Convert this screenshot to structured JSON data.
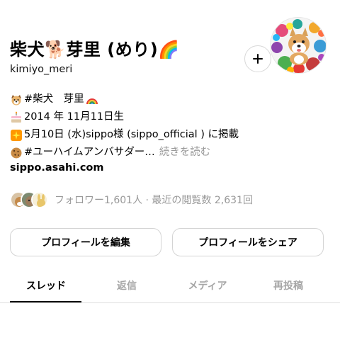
{
  "profile": {
    "display_name": "柴犬🐕芽里 (めり)🌈",
    "username": "kimiyo_meri"
  },
  "bio": {
    "line1_text": "#柴犬　芽里",
    "line2_text": "2014 年 11月11日生",
    "line3_text": "5月10日 (水)sippo様 (sippo_official ) に掲載",
    "line4_text": "#ユーハイムアンバサダー…",
    "more_label": "続きを読む",
    "link_text": "sippo.asahi.com"
  },
  "followers": {
    "text": "フォロワー1,601人 · 最近の閲覧数 2,631回"
  },
  "actions": {
    "edit_label": "プロフィールを編集",
    "share_label": "プロフィールをシェア"
  },
  "tabs": [
    "スレッド",
    "返信",
    "メディア",
    "再投稿"
  ],
  "active_tab": "スレッド",
  "icons": [
    "dog-face-icon",
    "birthday-cake-icon",
    "sparkle-burst-icon",
    "cookie-icon",
    "rainbow-icon",
    "plus-icon"
  ]
}
